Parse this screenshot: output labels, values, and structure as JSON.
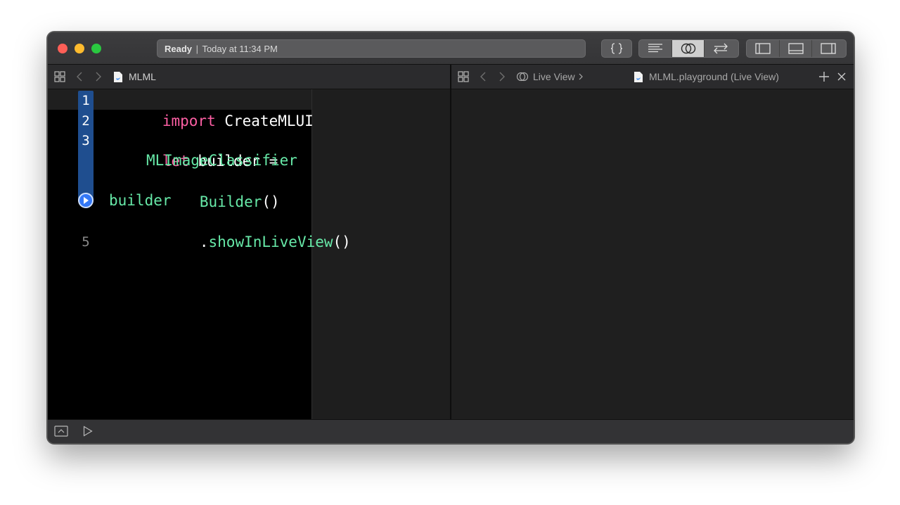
{
  "window": {
    "activity": {
      "status": "Ready",
      "separator": "|",
      "time": "Today at 11:34 PM"
    },
    "toolbar": {
      "icons": [
        "braces-icon",
        "standard-editor-icon",
        "assistant-editor-icon",
        "version-editor-icon",
        "navigator-toggle-icon",
        "debug-area-toggle-icon",
        "inspector-toggle-icon"
      ],
      "active": "assistant-editor-icon"
    }
  },
  "editor": {
    "jumpbar": {
      "file": "MLML"
    },
    "lines": [
      {
        "number": "1"
      },
      {
        "number": "2"
      },
      {
        "number": "3"
      },
      {
        "number": "5"
      }
    ],
    "code": {
      "line1_kw": "import",
      "line1_rest": " CreateMLUI",
      "line3_kw": "let",
      "line3_rest": " builder =",
      "line3_cont1": "MLImageClassifier",
      "line3_cont2_type": "Builder",
      "line3_cont2_rest": "()",
      "line4_a": "builder",
      "line4_dot": ".",
      "line4_fn": "showInLiveView",
      "line4_rest": "()"
    }
  },
  "assistant": {
    "jumpbar": {
      "segment1": "Live View",
      "segment2": "MLML.playground (Live View)"
    }
  },
  "colors": {
    "keyword": "#fc5fa3",
    "type": "#67e9a8",
    "gutter_highlight": "#1f4e8f",
    "run_button": "#3478f6"
  }
}
